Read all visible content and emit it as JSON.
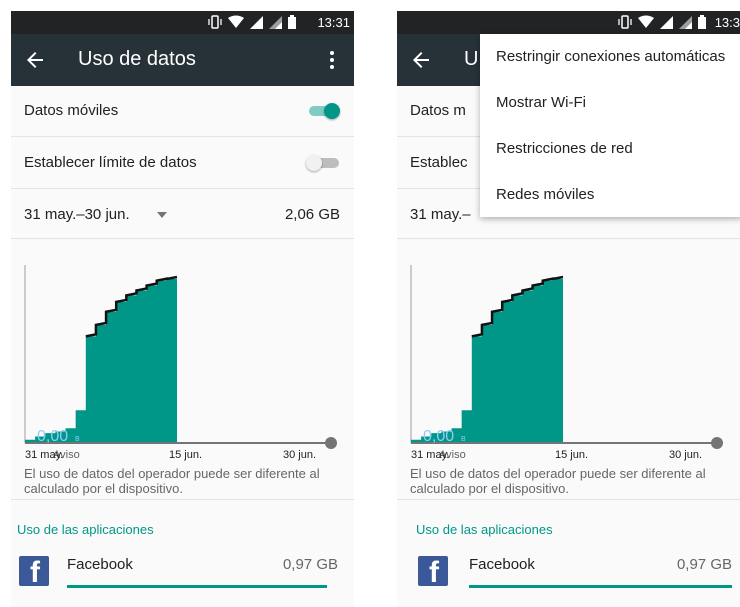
{
  "status_bar": {
    "time": "13:31",
    "time_clipped": "13:3"
  },
  "app_bar": {
    "title": "Uso de datos",
    "title_clipped": "U"
  },
  "rows": {
    "mobile_data": {
      "label": "Datos móviles",
      "label_clipped": "Datos m",
      "toggle_on": true
    },
    "data_limit": {
      "label": "Establecer límite de datos",
      "label_clipped": "Establec",
      "toggle_on": false
    }
  },
  "period": {
    "label": "31 may.–30 jun.",
    "label_clipped": "31 may.–",
    "total": "2,06 GB"
  },
  "chart_data": {
    "type": "area",
    "x": [
      "31 may.",
      "15 jun.",
      "30 jun."
    ],
    "x_tick_labels": [
      "31 may.",
      "15 jun.",
      "30 jun."
    ],
    "warning_label": "Aviso",
    "limit_label": "0,00",
    "limit_unit": "B",
    "color": "#009688",
    "cumulative_usage_points": [
      [
        0,
        0.02
      ],
      [
        1,
        0.04
      ],
      [
        2,
        0.06
      ],
      [
        3,
        0.07
      ],
      [
        4,
        0.09
      ],
      [
        5,
        0.2
      ],
      [
        6,
        0.65
      ],
      [
        7,
        0.72
      ],
      [
        8,
        0.8
      ],
      [
        9,
        0.86
      ],
      [
        10,
        0.9
      ],
      [
        11,
        0.93
      ],
      [
        12,
        0.96
      ],
      [
        13,
        0.99
      ],
      [
        14,
        1.0
      ]
    ],
    "period_days": 30
  },
  "note": "El uso de datos del operador puede ser diferente al calculado por el dispositivo.",
  "app_usage": {
    "section_title": "Uso de las aplicaciones",
    "items": [
      {
        "name": "Facebook",
        "usage": "0,97 GB",
        "icon": "facebook-icon",
        "fraction": 1.0
      }
    ]
  },
  "overflow_menu": {
    "items": [
      "Restringir conexiones automáticas",
      "Mostrar Wi-Fi",
      "Restricciones de red",
      "Redes móviles"
    ]
  },
  "colors": {
    "accent": "#009688",
    "app_bar": "#263238",
    "status_bar": "#222325"
  }
}
